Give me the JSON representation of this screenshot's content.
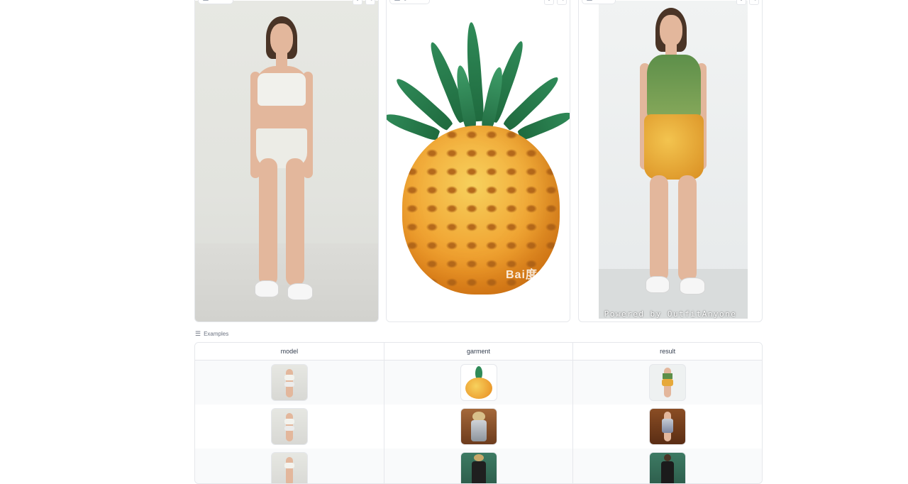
{
  "panels": {
    "model": {
      "label": "model"
    },
    "garment": {
      "label": "garment",
      "watermark": "Bai度"
    },
    "result": {
      "label": "result",
      "powered_by": "Powered by OutfitAnyone"
    }
  },
  "panel_actions": {
    "download_icon": "↓",
    "share_icon": "⋖"
  },
  "examples": {
    "title": "Examples",
    "columns": [
      "model",
      "garment",
      "result"
    ],
    "rows": [
      {
        "model": "model-standing-thumb",
        "garment": "pineapple-thumb",
        "result": "pineapple-dress-thumb"
      },
      {
        "model": "model-standing-thumb",
        "garment": "silver-outfit-thumb",
        "result": "silver-outfit-result-thumb"
      },
      {
        "model": "model-standing-thumb",
        "garment": "black-dress-thumb",
        "result": "black-dress-result-thumb"
      }
    ]
  },
  "colors": {
    "border": "#e5e7eb",
    "muted_text": "#6b7280",
    "skin": "#e3b79c",
    "hair": "#4a3426"
  }
}
